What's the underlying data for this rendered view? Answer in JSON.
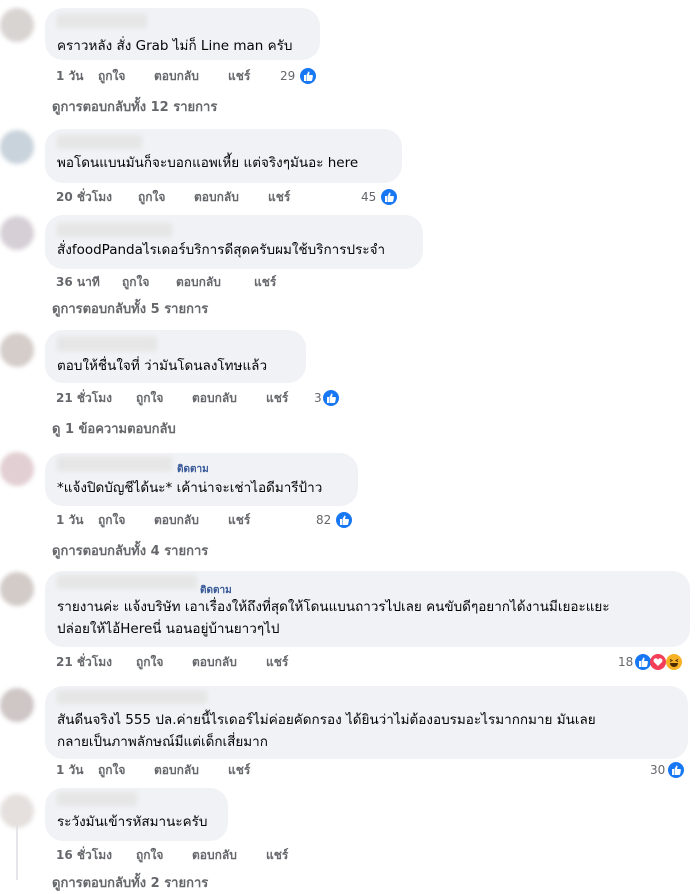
{
  "comments": [
    {
      "text": "คราวหลัง สั่ง Grab ไม่ก็ Line man ครับ",
      "time": "1 วัน",
      "like": "ถูกใจ",
      "reply": "ตอบกลับ",
      "share": "แชร์",
      "reactions": "29",
      "view_replies": "ดูการตอบกลับทั้ง 12 รายการ"
    },
    {
      "text": "พอโดนแบนมันก็จะบอกแอพเหี้ย แต่จริงๆมันอะ here",
      "time": "20 ชั่วโมง",
      "like": "ถูกใจ",
      "reply": "ตอบกลับ",
      "share": "แชร์",
      "reactions": "45"
    },
    {
      "text": "สั่งfoodPandaไรเดอร์บริการดีสุดครับผมใช้บริการประจำ",
      "time": "36 นาที",
      "like": "ถูกใจ",
      "reply": "ตอบกลับ",
      "share": "แชร์",
      "view_replies": "ดูการตอบกลับทั้ง 5 รายการ"
    },
    {
      "text": "ตอบให้ชื่นใจที่ ว่ามันโดนลงโทษแล้ว",
      "time": "21 ชั่วโมง",
      "like": "ถูกใจ",
      "reply": "ตอบกลับ",
      "share": "แชร์",
      "reactions": "3",
      "view_replies": "ดู 1 ข้อความตอบกลับ"
    },
    {
      "follow": "ติดตาม",
      "text": "*แจ้งปิดบัญชีได้นะ* เค้าน่าจะเช่าไอดีมารีป้าว",
      "time": "1 วัน",
      "like": "ถูกใจ",
      "reply": "ตอบกลับ",
      "share": "แชร์",
      "reactions": "82",
      "view_replies": "ดูการตอบกลับทั้ง 4 รายการ"
    },
    {
      "follow": "ติดตาม",
      "text_line1": "รายงานค่ะ แจ้งบริษัท เอาเรื่องให้ถึงที่สุดให้โดนแบนถาวรไปเลย คนขับดีๆอยากได้งานมีเยอะแยะ",
      "text_line2": "ปล่อยให้ไอ้Hereนี่ นอนอยู่บ้านยาวๆไป",
      "time": "21 ชั่วโมง",
      "like": "ถูกใจ",
      "reply": "ตอบกลับ",
      "share": "แชร์",
      "reactions": "18"
    },
    {
      "text_line1": "สันดีนจริงไ 555 ปล.ค่ายนี้ไรเดอร์ไม่ค่อยคัดกรอง ได้ยินว่าไม่ต้องอบรมอะไรมากกมาย มันเลย",
      "text_line2": "กลายเป็นภาพลักษณ์มีแต่เด็กเสี่ยมาก",
      "time": "1 วัน",
      "like": "ถูกใจ",
      "reply": "ตอบกลับ",
      "share": "แชร์",
      "reactions": "30"
    },
    {
      "text": "ระวังมันเข้ารหัสมานะครับ",
      "time": "16 ชั่วโมง",
      "like": "ถูกใจ",
      "reply": "ตอบกลับ",
      "share": "แชร์",
      "view_replies": "ดูการตอบกลับทั้ง 2 รายการ"
    }
  ],
  "colors": {
    "like_blue": "#1877f2",
    "bubble": "#f0f2f5",
    "meta": "#65676b",
    "love": "#f33e58",
    "haha": "#f7b125"
  },
  "icons": [
    "like-icon",
    "love-icon",
    "haha-icon"
  ]
}
